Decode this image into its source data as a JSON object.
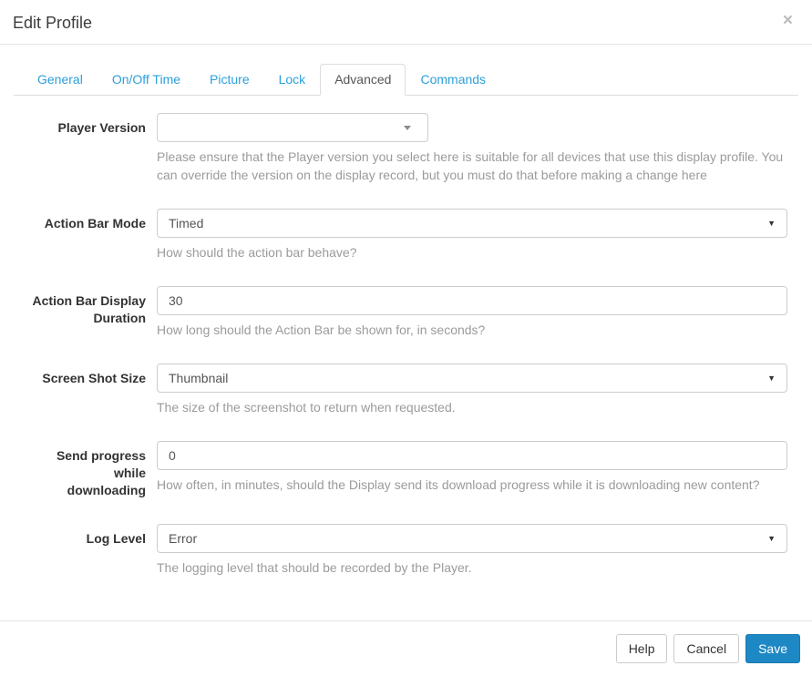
{
  "modal": {
    "title": "Edit Profile",
    "close": "×"
  },
  "tabs": {
    "active": "Advanced",
    "items": [
      {
        "label": "General"
      },
      {
        "label": "On/Off Time"
      },
      {
        "label": "Picture"
      },
      {
        "label": "Lock"
      },
      {
        "label": "Advanced"
      },
      {
        "label": "Commands"
      }
    ]
  },
  "form": {
    "player_version": {
      "label": "Player Version",
      "value": "",
      "help": "Please ensure that the Player version you select here is suitable for all devices that use this display profile. You can override the version on the display record, but you must do that before making a change here"
    },
    "action_bar_mode": {
      "label": "Action Bar Mode",
      "value": "Timed",
      "help": "How should the action bar behave?"
    },
    "action_bar_display_duration": {
      "label": "Action Bar Display Duration",
      "value": "30",
      "help": "How long should the Action Bar be shown for, in seconds?"
    },
    "screen_shot_size": {
      "label": "Screen Shot Size",
      "value": "Thumbnail",
      "help": "The size of the screenshot to return when requested."
    },
    "send_progress": {
      "label": "Send progress while downloading",
      "value": "0",
      "help": "How often, in minutes, should the Display send its download progress while it is downloading new content?"
    },
    "log_level": {
      "label": "Log Level",
      "value": "Error",
      "help": "The logging level that should be recorded by the Player."
    }
  },
  "footer": {
    "help": "Help",
    "cancel": "Cancel",
    "save": "Save"
  },
  "colors": {
    "link_blue": "#2d9fd9",
    "primary_blue": "#1e88c5",
    "border_gray": "#dddddd",
    "help_gray": "#9b9b9b"
  }
}
